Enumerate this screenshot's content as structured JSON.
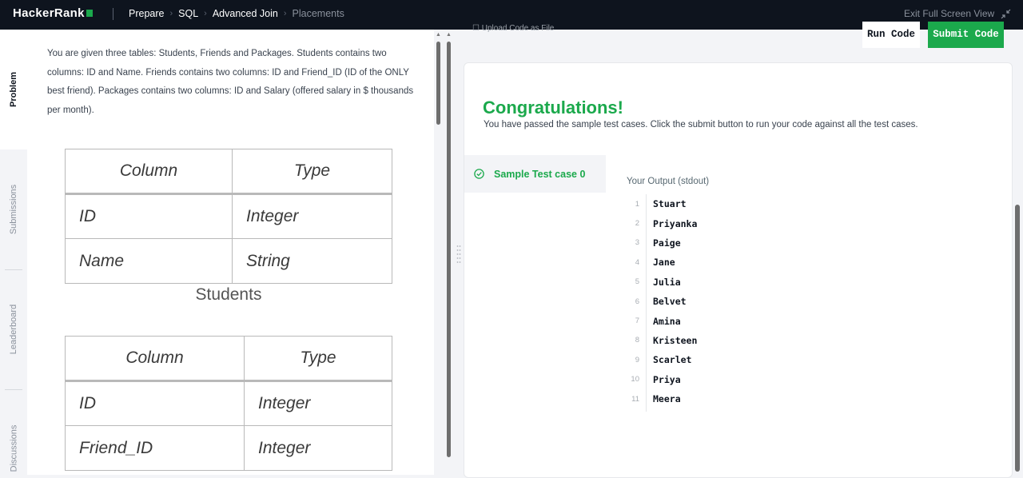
{
  "nav": {
    "logo": "HackerRank",
    "breadcrumbs": [
      "Prepare",
      "SQL",
      "Advanced Join",
      "Placements"
    ],
    "exit_fullscreen": "Exit Full Screen View"
  },
  "side_tabs": [
    "Problem",
    "Submissions",
    "Leaderboard",
    "Discussions"
  ],
  "problem": {
    "description": "You are given three tables: Students, Friends and Packages. Students contains two columns: ID and Name. Friends contains two columns: ID and Friend_ID (ID of the ONLY best friend). Packages contains two columns: ID and Salary (offered salary in $ thousands per month).",
    "students_table": {
      "headers": [
        "Column",
        "Type"
      ],
      "rows": [
        [
          "ID",
          "Integer"
        ],
        [
          "Name",
          "String"
        ]
      ],
      "caption": "Students"
    },
    "friends_table": {
      "headers": [
        "Column",
        "Type"
      ],
      "rows": [
        [
          "ID",
          "Integer"
        ],
        [
          "Friend_ID",
          "Integer"
        ]
      ]
    }
  },
  "editor": {
    "upload_label": "Upload Code as File",
    "run_label": "Run Code",
    "submit_label": "Submit Code"
  },
  "results": {
    "title": "Congratulations!",
    "subtitle": "You have passed the sample test cases. Click the submit button to run your code against all the test cases.",
    "testcase_label": "Sample Test case 0",
    "output_label": "Your Output (stdout)",
    "output_lines": [
      {
        "n": "1",
        "v": "Stuart"
      },
      {
        "n": "2",
        "v": "Priyanka"
      },
      {
        "n": "3",
        "v": "Paige"
      },
      {
        "n": "4",
        "v": "Jane"
      },
      {
        "n": "5",
        "v": "Julia"
      },
      {
        "n": "6",
        "v": "Belvet"
      },
      {
        "n": "7",
        "v": "Amina"
      },
      {
        "n": "8",
        "v": "Kristeen"
      },
      {
        "n": "9",
        "v": "Scarlet"
      },
      {
        "n": "10",
        "v": "Priya"
      },
      {
        "n": "11",
        "v": "Meera"
      }
    ]
  },
  "colors": {
    "nav_bg": "#0e141e",
    "accent_green": "#1ba94c"
  }
}
